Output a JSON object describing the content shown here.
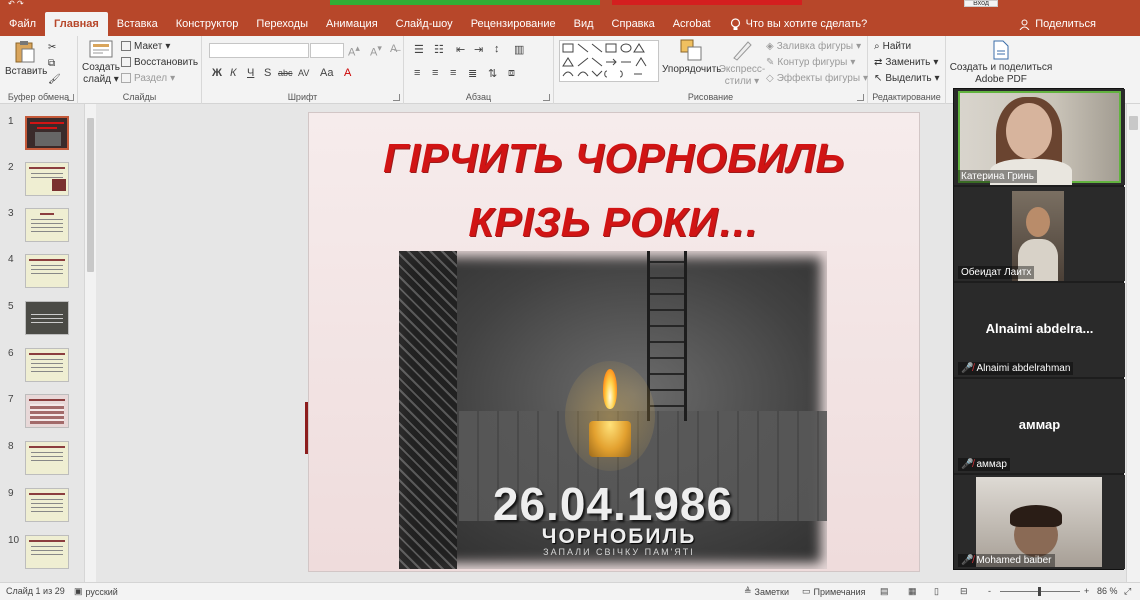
{
  "app": {
    "login_label": "Вход",
    "tabs": [
      "Файл",
      "Главная",
      "Вставка",
      "Конструктор",
      "Переходы",
      "Анимация",
      "Слайд-шоу",
      "Рецензирование",
      "Вид",
      "Справка",
      "Acrobat"
    ],
    "active_tab": "Главная",
    "tell_me": "Что вы хотите сделать?",
    "share": "Поделиться",
    "accent_color": "#b7472a"
  },
  "ribbon": {
    "clipboard": {
      "paste": "Вставить",
      "label": "Буфер обмена"
    },
    "slides": {
      "new_slide_line1": "Создать",
      "new_slide_line2": "слайд",
      "layout": "Макет",
      "reset": "Восстановить",
      "section": "Раздел",
      "label": "Слайды"
    },
    "font": {
      "bold": "Ж",
      "italic": "К",
      "underline": "Ч",
      "shadow": "S",
      "strike": "abc",
      "spacing": "AV",
      "case": "Aa",
      "label": "Шрифт"
    },
    "paragraph": {
      "label": "Абзац"
    },
    "drawing": {
      "arrange": "Упорядочить",
      "quick_styles_line1": "Экспресс-",
      "quick_styles_line2": "стили",
      "fill": "Заливка фигуры",
      "outline": "Контур фигуры",
      "effects": "Эффекты фигуры",
      "label": "Рисование"
    },
    "editing": {
      "find": "Найти",
      "replace": "Заменить",
      "select": "Выделить",
      "label": "Редактирование"
    },
    "adobe": {
      "line1": "Создать и поделиться",
      "line2": "Adobe PDF"
    }
  },
  "thumbnails": {
    "numbers": [
      "1",
      "2",
      "3",
      "4",
      "5",
      "6",
      "7",
      "8",
      "9",
      "10"
    ],
    "selected": "1"
  },
  "slide": {
    "title_line1": "ГІРЧИТЬ ЧОРНОБИЛЬ",
    "title_line2": "КРІЗЬ РОКИ…",
    "date": "26.04.1986",
    "caption": "ЧОРНОБИЛЬ",
    "subcaption": "ЗАПАЛИ СВІЧКУ ПАМ'ЯТІ",
    "title_color": "#d11414"
  },
  "participants": [
    {
      "name": "Катерина Гринь",
      "has_video": true
    },
    {
      "name": "Обеидат Лаитх",
      "has_video": true
    },
    {
      "name": "Alnaimi abdelrahman",
      "display": "Alnaimi  abdelra...",
      "has_video": false,
      "muted": true
    },
    {
      "name": "аммар",
      "display": "аммар",
      "has_video": false,
      "muted": true
    },
    {
      "name": "Mohamed baiber",
      "has_video": true,
      "muted": true
    }
  ],
  "status": {
    "slide_info": "Слайд 1 из 29",
    "language": "русский",
    "notes": "Заметки",
    "comments": "Примечания",
    "zoom": "86 %",
    "zoom_minus": "-",
    "zoom_plus": "+"
  }
}
